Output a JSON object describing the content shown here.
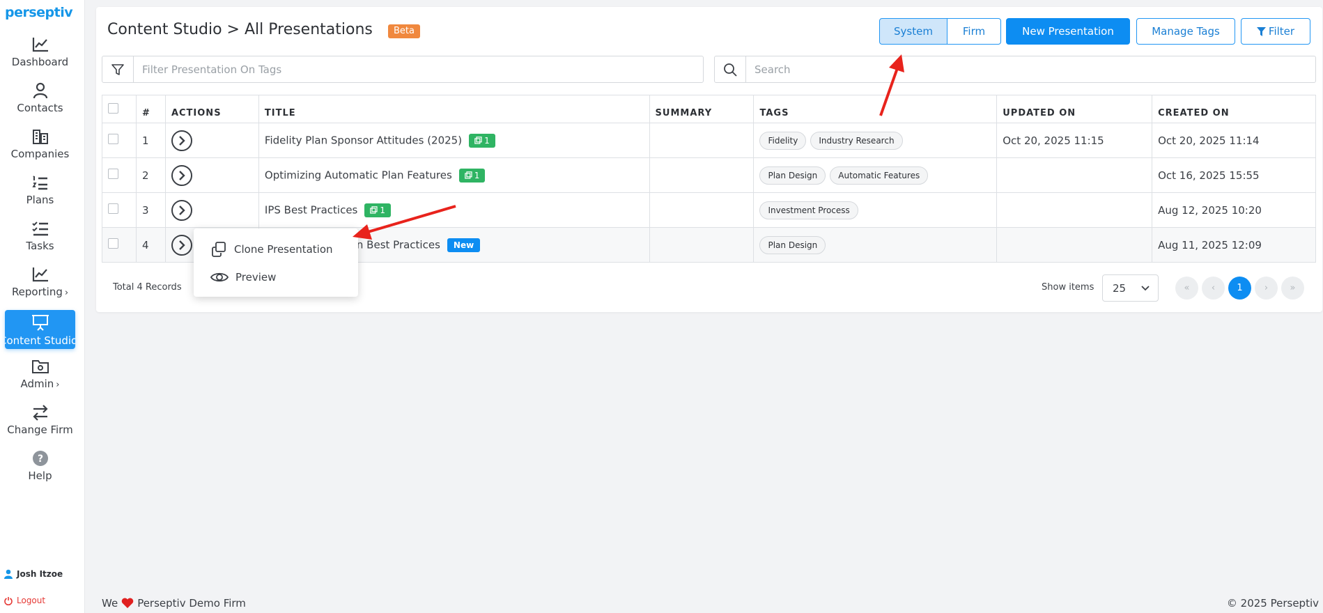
{
  "brand": {
    "logo_text": "perseptiv",
    "accent": "#1596e8"
  },
  "sidebar": {
    "items": [
      {
        "label": "Dashboard",
        "icon": "line-chart-icon"
      },
      {
        "label": "Contacts",
        "icon": "person-icon"
      },
      {
        "label": "Companies",
        "icon": "buildings-icon"
      },
      {
        "label": "Plans",
        "icon": "numbered-list-icon"
      },
      {
        "label": "Tasks",
        "icon": "checklist-icon"
      },
      {
        "label": "Reporting",
        "icon": "chart-icon",
        "chevron": "›"
      },
      {
        "label": "Content Studio",
        "icon": "presentation-icon",
        "active": true
      },
      {
        "label": "Admin",
        "icon": "folder-gear-icon",
        "chevron": "›"
      },
      {
        "label": "Change Firm",
        "icon": "swap-arrows-icon"
      },
      {
        "label": "Help",
        "icon": "help-icon"
      }
    ],
    "user_name": "Josh Itzoe",
    "logout_label": "Logout"
  },
  "header": {
    "title": "Content Studio > All Presentations",
    "beta_badge": "Beta",
    "system_label": "System",
    "firm_label": "Firm",
    "new_presentation_label": "New Presentation",
    "manage_tags_label": "Manage Tags",
    "filter_label": "Filter"
  },
  "filters": {
    "tag_placeholder": "Filter Presentation On Tags",
    "search_placeholder": "Search"
  },
  "table": {
    "columns": [
      "#",
      "ACTIONS",
      "TITLE",
      "SUMMARY",
      "TAGS",
      "UPDATED ON",
      "CREATED ON"
    ],
    "rows": [
      {
        "num": "1",
        "title": "Fidelity Plan Sponsor Attitudes (2025)",
        "badge": "1",
        "summary": "",
        "tags": [
          "Fidelity",
          "Industry Research"
        ],
        "updated": "Oct 20, 2025 11:15",
        "created": "Oct 20, 2025 11:14"
      },
      {
        "num": "2",
        "title": "Optimizing Automatic Plan Features",
        "badge": "1",
        "summary": "",
        "tags": [
          "Plan Design",
          "Automatic Features"
        ],
        "updated": "",
        "created": "Oct 16, 2025 15:55"
      },
      {
        "num": "3",
        "title": "IPS Best Practices",
        "badge": "1",
        "summary": "",
        "tags": [
          "Investment Process"
        ],
        "updated": "",
        "created": "Aug 12, 2025 10:20"
      },
      {
        "num": "4",
        "title": "n Best Practices",
        "new_badge": "New",
        "summary": "",
        "tags": [
          "Plan Design"
        ],
        "updated": "",
        "created": "Aug 11, 2025 12:09"
      }
    ]
  },
  "pagination": {
    "total_records": "Total 4 Records",
    "show_items_label": "Show items",
    "page_size": "25",
    "first": "«",
    "prev": "‹",
    "current_page": "1",
    "next": "›",
    "last": "»"
  },
  "context_menu": {
    "clone_label": "Clone Presentation",
    "preview_label": "Preview"
  },
  "footer": {
    "left_prefix": "We",
    "left_suffix": "Perseptiv Demo Firm",
    "right": "© 2025 Perseptiv"
  },
  "colors": {
    "primary": "#0d8df2",
    "success": "#2fb463",
    "beta": "#f0883e",
    "danger": "#e53935",
    "annotation": "#e8231c"
  }
}
